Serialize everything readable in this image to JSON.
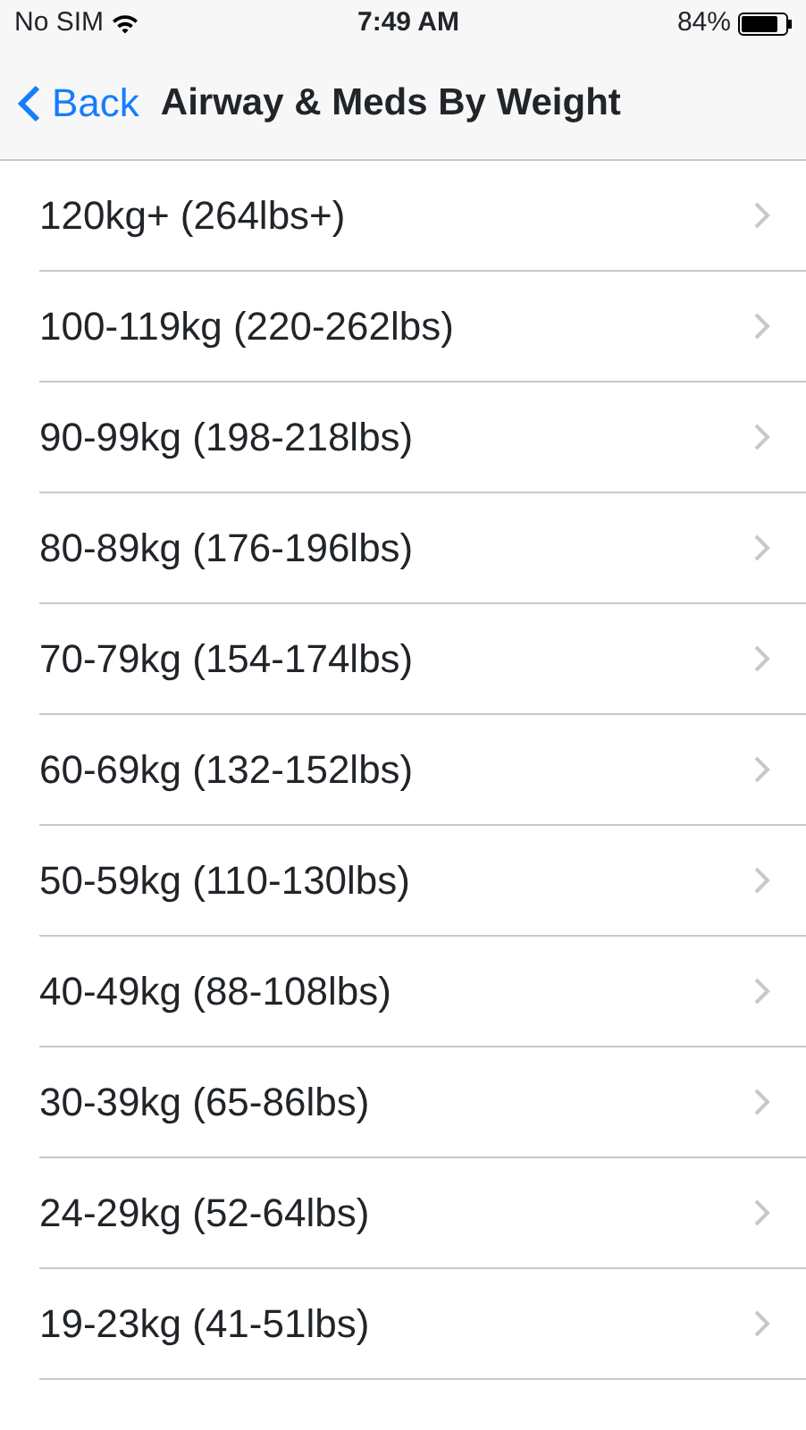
{
  "status_bar": {
    "carrier": "No SIM",
    "time": "7:49 AM",
    "battery": "84%"
  },
  "nav_bar": {
    "back": "Back",
    "title": "Airway & Meds By Weight"
  },
  "rows": [
    {
      "label": "120kg+ (264lbs+)"
    },
    {
      "label": "100-119kg (220-262lbs)"
    },
    {
      "label": "90-99kg (198-218lbs)"
    },
    {
      "label": "80-89kg (176-196lbs)"
    },
    {
      "label": "70-79kg (154-174lbs)"
    },
    {
      "label": "60-69kg (132-152lbs)"
    },
    {
      "label": "50-59kg (110-130lbs)"
    },
    {
      "label": "40-49kg (88-108lbs)"
    },
    {
      "label": "30-39kg (65-86lbs)"
    },
    {
      "label": "24-29kg (52-64lbs)"
    },
    {
      "label": "19-23kg (41-51lbs)"
    }
  ]
}
